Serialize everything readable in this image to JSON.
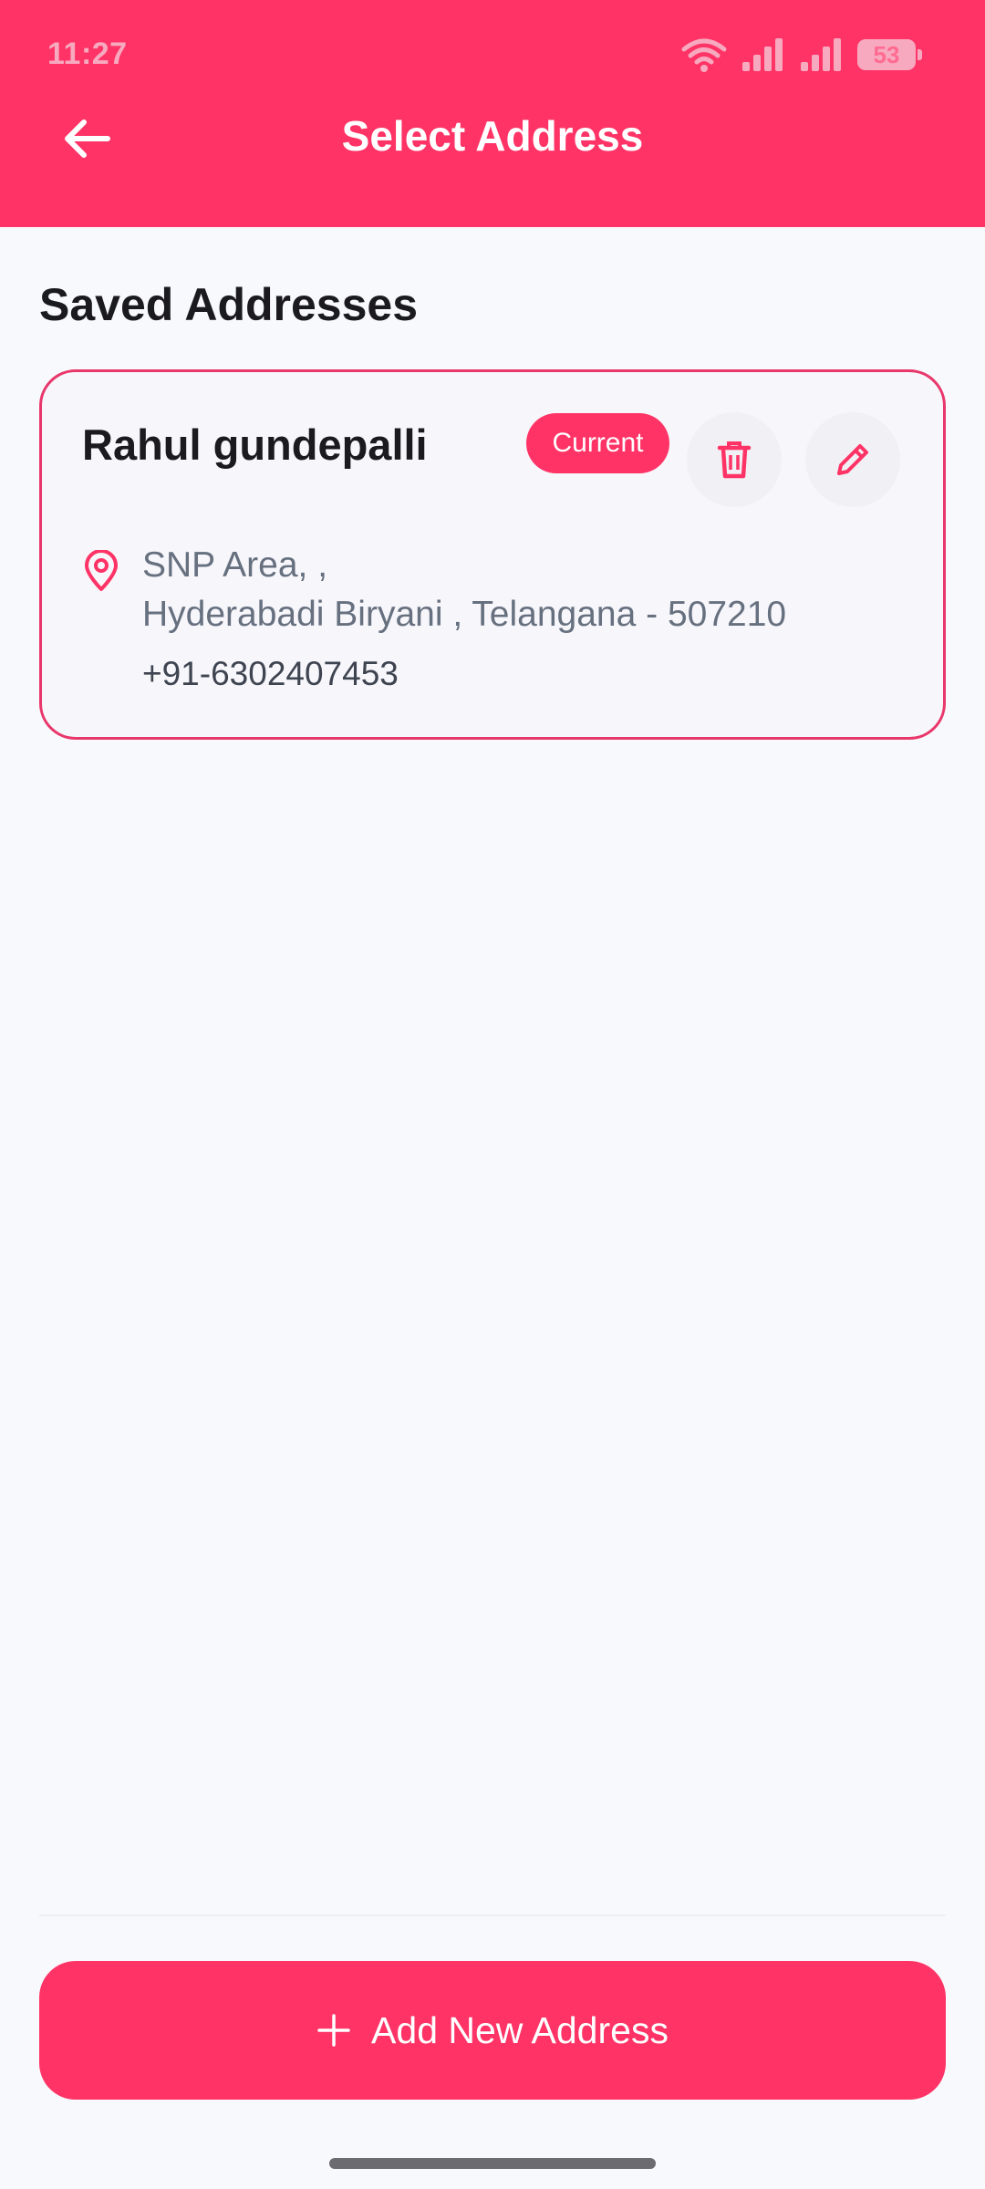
{
  "status_bar": {
    "time": "11:27",
    "battery": "53"
  },
  "header": {
    "title": "Select Address",
    "back_icon": "arrow-left-icon"
  },
  "section": {
    "title": "Saved Addresses"
  },
  "address_card": {
    "name": "Rahul gundepalli",
    "badge": "Current",
    "address_line1": "SNP Area, ,",
    "address_line2": "Hyderabadi Biryani , Telangana - 507210",
    "phone": "+91-6302407453",
    "icons": [
      "trash-icon",
      "pencil-icon",
      "location-pin-icon"
    ]
  },
  "footer": {
    "add_button_label": "Add New Address",
    "add_icon": "plus-icon"
  },
  "colors": {
    "primary": "#ff3366",
    "card_border": "#e8376a",
    "background": "#f8f9fc"
  }
}
